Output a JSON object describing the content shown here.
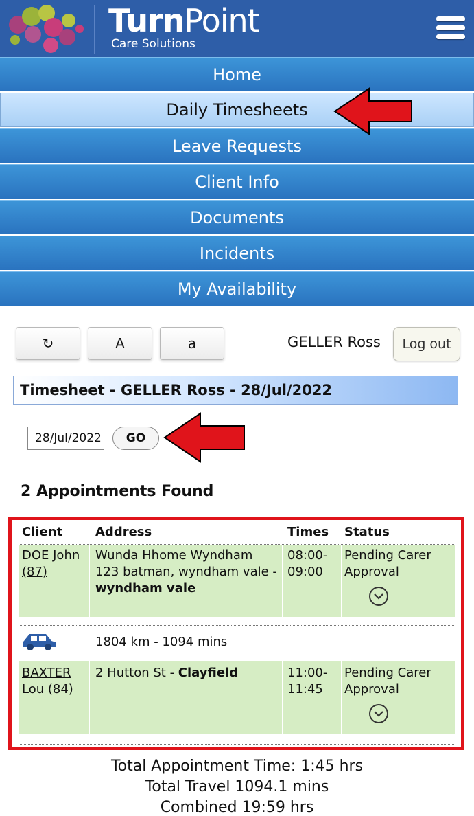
{
  "header": {
    "brand_name_bold": "Turn",
    "brand_name_light": "Point",
    "brand_sub": "Care Solutions",
    "logo_icon": "dots-logo-icon",
    "menu_icon": "hamburger-menu-icon",
    "color": "#2e5ea8"
  },
  "nav": {
    "items": [
      {
        "label": "Home"
      },
      {
        "label": "Daily Timesheets",
        "active": true
      },
      {
        "label": "Leave Requests"
      },
      {
        "label": "Client Info"
      },
      {
        "label": "Documents"
      },
      {
        "label": "Incidents"
      },
      {
        "label": "My Availability"
      }
    ]
  },
  "toolbar": {
    "refresh_label": "↻",
    "font_large_label": "A",
    "font_small_label": "a",
    "user_name": "GELLER Ross",
    "logout_label": "Log out"
  },
  "timesheet": {
    "title": "Timesheet - GELLER Ross - 28/Jul/2022",
    "date_value": "28/Jul/2022",
    "go_label": "GO",
    "found_text": "2 Appointments Found"
  },
  "table": {
    "headers": {
      "client": "Client",
      "address": "Address",
      "times": "Times",
      "status": "Status"
    },
    "rows": [
      {
        "client_line1": "DOE John",
        "client_line2": "(87)",
        "address_line1": "Wunda Hhome Wyndham",
        "address_line2": "123 batman, wyndham vale -",
        "address_bold": "wyndham vale",
        "time_start": "08:00-",
        "time_end": "09:00",
        "status_line1": "Pending Carer",
        "status_line2": "Approval"
      },
      {
        "client_line1": "BAXTER",
        "client_line2": "Lou (84)",
        "address_line1": "2 Hutton St - ",
        "address_bold": "Clayfield",
        "time_start": "11:00-",
        "time_end": "11:45",
        "status_line1": "Pending Carer",
        "status_line2": "Approval"
      }
    ],
    "travel": {
      "icon": "car-icon",
      "text": "1804 km - 1094 mins"
    }
  },
  "totals": {
    "appointment": "Total Appointment Time: 1:45 hrs",
    "travel": "Total Travel 1094.1 mins",
    "combined": "Combined 19:59 hrs"
  },
  "annotations": {
    "arrow_color": "#e0141b",
    "frame_color": "#e0141b"
  }
}
